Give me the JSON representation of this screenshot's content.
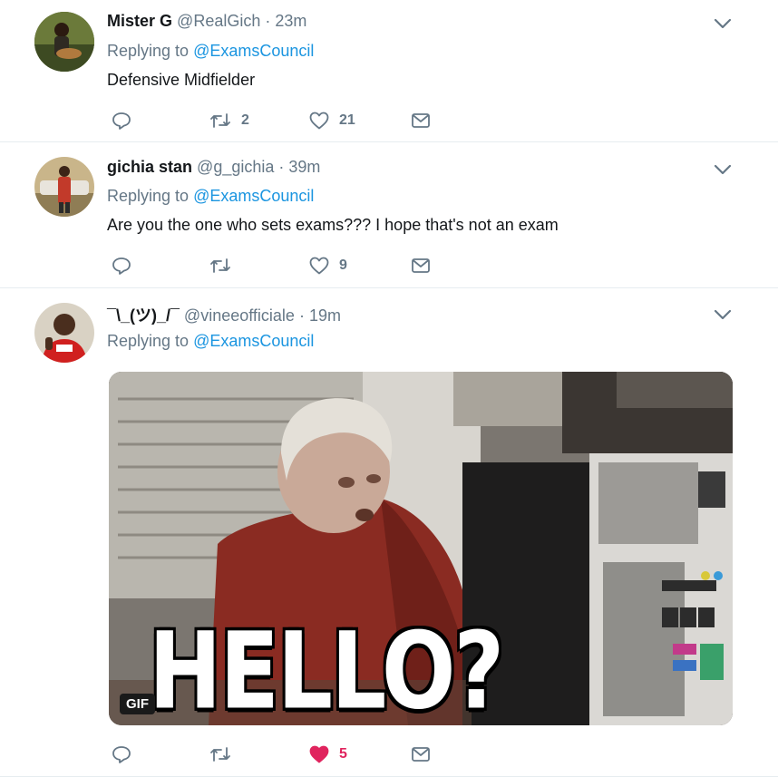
{
  "tweets": [
    {
      "name": "Mister G",
      "handle": "@RealGich",
      "time": "· 23m",
      "replying_prefix": "Replying to",
      "replying_to": "@ExamsCouncil",
      "text": "Defensive Midfielder",
      "retweets": "2",
      "likes": "21"
    },
    {
      "name": "gichia stan",
      "handle": "@g_gichia",
      "time": "· 39m",
      "replying_prefix": "Replying to",
      "replying_to": "@ExamsCouncil",
      "text": "Are you the one who sets exams??? I hope that's not an exam",
      "retweets": "",
      "likes": "9"
    },
    {
      "name": "¯\\_(ツ)_/¯",
      "handle": "@vineeofficiale",
      "time": "· 19m",
      "replying_prefix": "Replying to",
      "replying_to": "@ExamsCouncil",
      "media": {
        "type": "gif",
        "badge": "GIF",
        "caption": "HELLO?"
      },
      "retweets": "",
      "likes": "5",
      "liked": true
    }
  ],
  "colors": {
    "link": "#1b95e0",
    "secondary": "#657786",
    "like_active": "#e0245e",
    "divider": "#e6ecf0"
  },
  "icons": [
    "reply-icon",
    "retweet-icon",
    "like-icon",
    "dm-icon",
    "caret-down-icon"
  ]
}
